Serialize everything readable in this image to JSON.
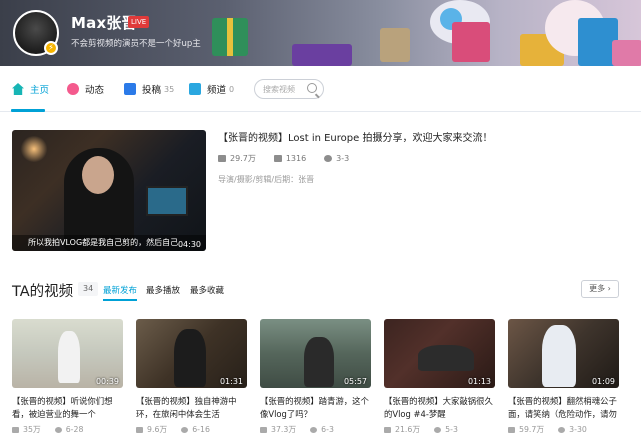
{
  "header": {
    "username": "Max张晋",
    "live_badge": "LIVE",
    "signature": "不会剪视频的演员不是一个好up主"
  },
  "nav": {
    "items": [
      {
        "label": "主页",
        "count": ""
      },
      {
        "label": "动态",
        "count": ""
      },
      {
        "label": "投稿",
        "count": "35"
      },
      {
        "label": "频道",
        "count": "0"
      }
    ],
    "search_placeholder": "搜索视频"
  },
  "featured": {
    "title": "【张晋的视频】Lost in Europe 拍摄分享，欢迎大家来交流！",
    "caption": "所以我拍VLOG都是我自己剪的，然后自己",
    "duration": "04:30",
    "views": "29.7万",
    "images": "1316",
    "date": "3-3",
    "credit": "导演/摄影/剪辑/后期：张晋"
  },
  "section": {
    "title": "TA的视频",
    "count": "34",
    "sort": [
      "最新发布",
      "最多播放",
      "最多收藏"
    ],
    "more": "更多"
  },
  "videos": [
    {
      "title": "【张晋的视频】听说你们想看，被迫营业的舞一个",
      "duration": "00:39",
      "views": "35万",
      "date": "6-28"
    },
    {
      "title": "【张晋的视频】独自神游中环，在旅闲中体会生活",
      "duration": "01:31",
      "views": "9.6万",
      "date": "6-16"
    },
    {
      "title": "【张晋的视频】踏青游，这个像Vlog了吗？",
      "duration": "05:57",
      "views": "37.3万",
      "date": "6-3"
    },
    {
      "title": "【张晋的视频】大家敲锅很久的Vlog #4-梦醒",
      "duration": "01:13",
      "views": "21.6万",
      "date": "5-3"
    },
    {
      "title": "【张晋的视频】翻然梢魂公子面，请笑纳（危险动作，请勿",
      "duration": "01:09",
      "views": "59.7万",
      "date": "3-30"
    }
  ]
}
